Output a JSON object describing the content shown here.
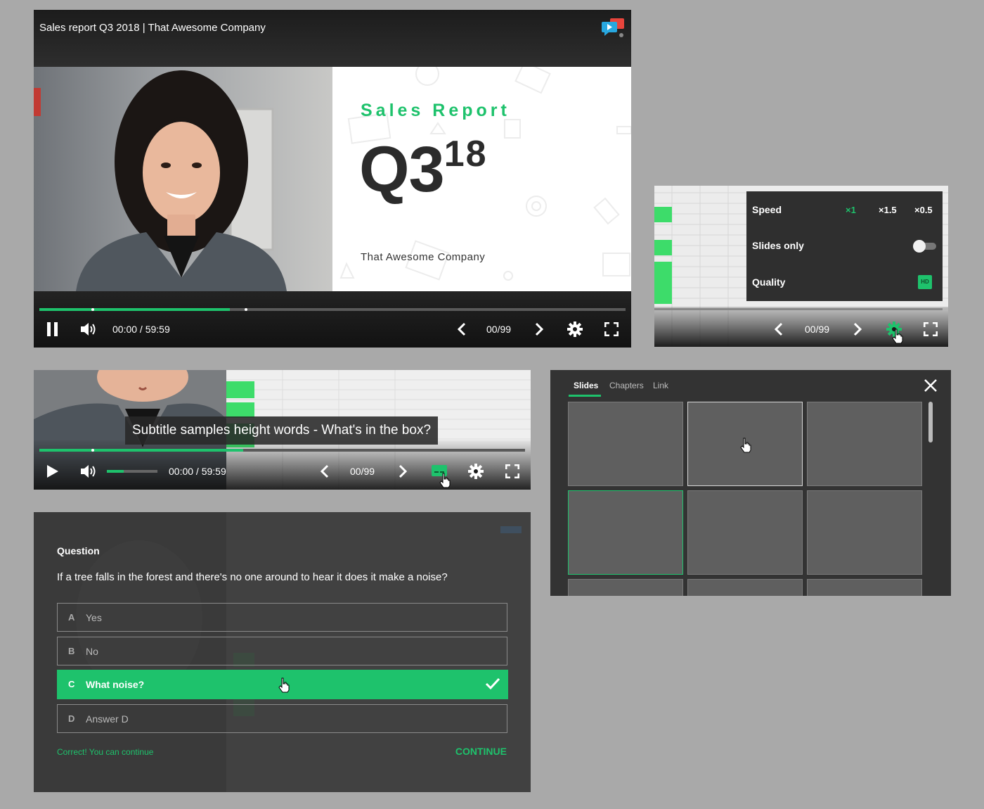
{
  "colors": {
    "accent": "#1ec26c",
    "panel": "#333333",
    "page_bg": "#a9a9a9"
  },
  "main_player": {
    "title": "Sales report Q3 2018 | That Awesome Company",
    "logo_icon": "presenter-logo-icon",
    "slide": {
      "heading": "Sales Report",
      "big": "Q3",
      "big_sup": "18",
      "company": "That Awesome Company"
    },
    "progress": {
      "played": 0.325,
      "buffer_marker": 0.35
    },
    "time": "00:00 / 59:59",
    "slide_counter": "00/99",
    "icons": [
      "pause-icon",
      "volume-icon",
      "chevron-left-icon",
      "chevron-right-icon",
      "gear-icon",
      "fullscreen-icon"
    ]
  },
  "settings_panel": {
    "speed": {
      "label": "Speed",
      "options": [
        "×1",
        "×1.5",
        "×0.5"
      ],
      "selected": "×1"
    },
    "slides_only": {
      "label": "Slides only",
      "on": false
    },
    "quality": {
      "label": "Quality",
      "badge": "HD"
    },
    "slide_counter": "00/99"
  },
  "subtitle_player": {
    "subtitle": "Subtitle samples height words - What's in the box?",
    "time": "00:00 / 59:59",
    "slide_counter": "00/99",
    "progress": {
      "played": 0.42
    },
    "volume": 0.33
  },
  "slides_panel": {
    "tabs": [
      "Slides",
      "Chapters",
      "Link"
    ],
    "active_tab": "Slides",
    "close_icon": "close-icon"
  },
  "question": {
    "label": "Question",
    "text": "If a tree falls in the forest and there's no one around to hear it does it make a noise?",
    "answers": [
      {
        "letter": "A",
        "text": "Yes"
      },
      {
        "letter": "B",
        "text": "No"
      },
      {
        "letter": "C",
        "text": "What noise?",
        "selected": true
      },
      {
        "letter": "D",
        "text": "Answer D"
      }
    ],
    "feedback": "Correct! You can continue",
    "continue_label": "CONTINUE"
  }
}
